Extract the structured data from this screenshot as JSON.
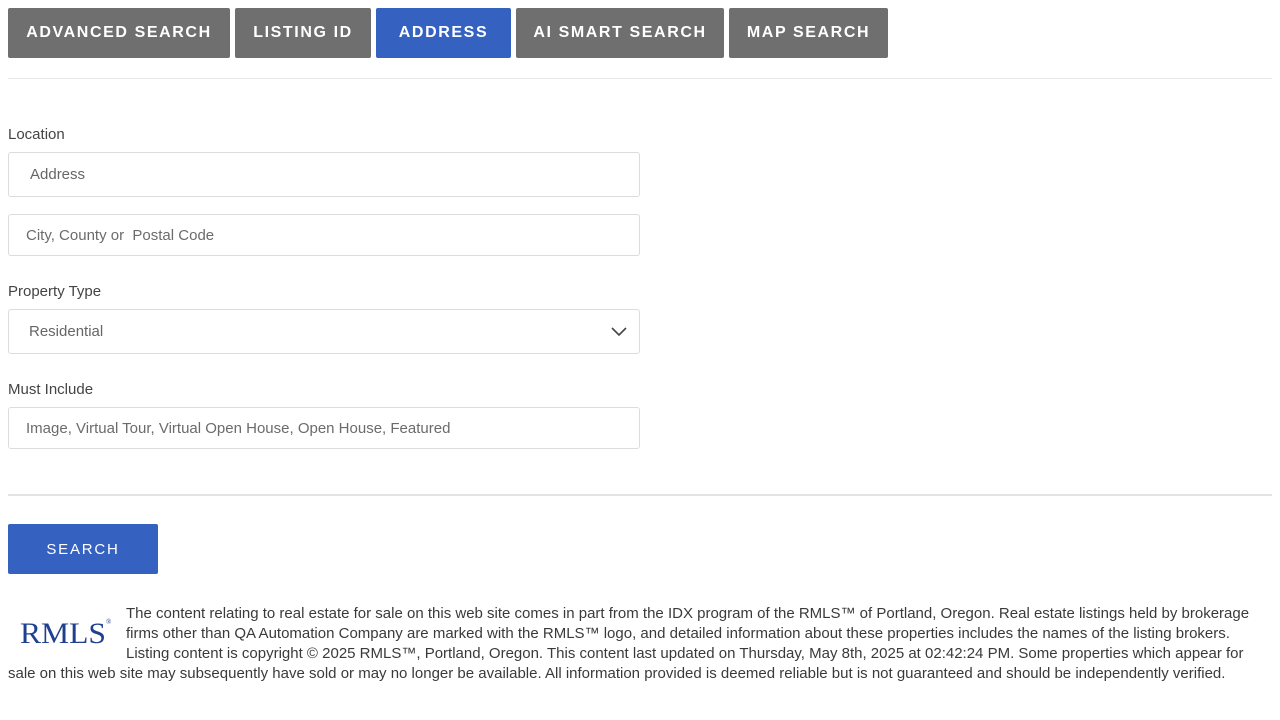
{
  "tabs": [
    {
      "label": "ADVANCED SEARCH",
      "active": false
    },
    {
      "label": "LISTING ID",
      "active": false
    },
    {
      "label": "ADDRESS",
      "active": true
    },
    {
      "label": "AI SMART SEARCH",
      "active": false
    },
    {
      "label": "MAP SEARCH",
      "active": false
    }
  ],
  "location": {
    "label": "Location",
    "address_value": "Address",
    "city_placeholder": "City, County or  Postal Code"
  },
  "property_type": {
    "label": "Property Type",
    "selected": "Residential"
  },
  "must_include": {
    "label": "Must Include",
    "placeholder": "Image, Virtual Tour, Virtual Open House, Open House, Featured"
  },
  "search_button": "SEARCH",
  "logo_text": "RMLS",
  "disclaimer": "The content relating to real estate for sale on this web site comes in part from the IDX program of the RMLS™ of Portland, Oregon. Real estate listings held by brokerage firms other than QA Automation Company are marked with the RMLS™ logo, and detailed information about these properties includes the names of the listing brokers. Listing content is copyright © 2025 RMLS™, Portland, Oregon. This content last updated on Thursday, May 8th, 2025 at 02:42:24 PM. Some properties which appear for sale on this web site may subsequently have sold or may no longer be available. All information provided is deemed reliable but is not guaranteed and should be independently verified.",
  "colors": {
    "tab_inactive": "#6f6f6f",
    "tab_active": "#3561c0",
    "button": "#3561c0",
    "logo": "#1f3f8f"
  }
}
